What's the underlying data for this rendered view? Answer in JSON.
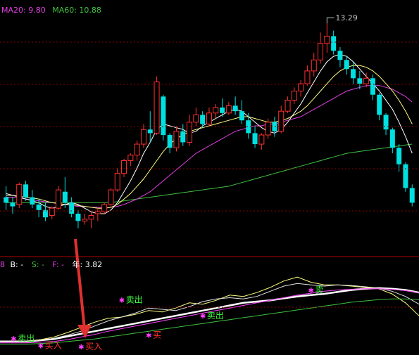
{
  "header": {
    "ma20_label": "MA20: 9.80",
    "ma60_label": "MA60: 10.88",
    "ma20_color": "#e040e0",
    "ma60_color": "#40c040"
  },
  "indicator_header": {
    "prefix": "8",
    "b_label": "B: -",
    "s_label": "S: -",
    "f_label": "F: -",
    "year_label": "年: 3.82",
    "b_color": "#ffffff",
    "s_color": "#40c040",
    "f_color": "#e040e0"
  },
  "chart_data": [
    {
      "type": "candlestick",
      "title": "",
      "up_color": "#ff3030",
      "down_color": "#00e0e0",
      "annotations": [
        {
          "text": "13.29",
          "at_candle": 49
        }
      ],
      "candles": [
        [
          9.9,
          10.5,
          9.2,
          9.6
        ],
        [
          9.6,
          9.9,
          9.0,
          9.4
        ],
        [
          9.5,
          10.7,
          9.3,
          10.6
        ],
        [
          10.6,
          10.8,
          9.7,
          9.9
        ],
        [
          9.9,
          10.3,
          9.3,
          9.5
        ],
        [
          9.5,
          9.8,
          8.8,
          9.2
        ],
        [
          9.2,
          9.6,
          8.6,
          8.8
        ],
        [
          8.9,
          9.4,
          8.7,
          9.3
        ],
        [
          9.3,
          10.5,
          9.2,
          10.3
        ],
        [
          10.2,
          11.0,
          9.3,
          9.6
        ],
        [
          9.6,
          9.9,
          8.8,
          9.0
        ],
        [
          9.0,
          9.2,
          8.2,
          8.6
        ],
        [
          8.6,
          9.0,
          8.4,
          8.7
        ],
        [
          8.7,
          9.1,
          8.2,
          8.9
        ],
        [
          9.0,
          9.3,
          8.6,
          9.1
        ],
        [
          9.1,
          9.6,
          9.0,
          9.5
        ],
        [
          9.5,
          10.4,
          9.4,
          10.3
        ],
        [
          10.3,
          11.5,
          10.2,
          11.2
        ],
        [
          11.2,
          12.0,
          11.0,
          11.9
        ],
        [
          11.9,
          12.3,
          11.6,
          12.2
        ],
        [
          12.2,
          13.0,
          11.9,
          12.8
        ],
        [
          12.8,
          13.9,
          12.6,
          13.6
        ],
        [
          13.6,
          14.6,
          12.9,
          13.4
        ],
        [
          13.4,
          16.5,
          13.3,
          16.2
        ],
        [
          15.4,
          15.5,
          13.0,
          13.3
        ],
        [
          13.3,
          13.4,
          12.3,
          12.6
        ],
        [
          12.6,
          13.8,
          12.4,
          13.5
        ],
        [
          13.5,
          13.9,
          12.7,
          12.9
        ],
        [
          12.9,
          14.4,
          12.7,
          14.0
        ],
        [
          14.0,
          14.8,
          13.8,
          14.4
        ],
        [
          14.4,
          14.6,
          13.7,
          13.9
        ],
        [
          13.9,
          14.8,
          13.8,
          14.5
        ],
        [
          14.5,
          15.0,
          14.2,
          14.8
        ],
        [
          14.8,
          15.3,
          14.3,
          14.5
        ],
        [
          14.5,
          15.1,
          14.4,
          14.9
        ],
        [
          14.9,
          15.4,
          14.4,
          14.6
        ],
        [
          14.6,
          15.2,
          13.9,
          14.1
        ],
        [
          14.1,
          14.5,
          13.1,
          13.4
        ],
        [
          13.4,
          13.8,
          12.6,
          12.8
        ],
        [
          12.8,
          13.4,
          12.5,
          13.3
        ],
        [
          13.3,
          14.2,
          13.1,
          14.0
        ],
        [
          14.0,
          14.3,
          13.2,
          13.5
        ],
        [
          13.5,
          14.9,
          13.4,
          14.6
        ],
        [
          14.6,
          15.4,
          14.5,
          15.2
        ],
        [
          15.2,
          15.9,
          15.0,
          15.7
        ],
        [
          15.7,
          16.3,
          15.4,
          16.1
        ],
        [
          16.1,
          17.1,
          16.0,
          16.8
        ],
        [
          16.8,
          17.8,
          16.5,
          17.4
        ],
        [
          17.4,
          18.9,
          17.2,
          18.3
        ],
        [
          18.3,
          19.4,
          17.8,
          18.7
        ],
        [
          18.7,
          19.0,
          17.7,
          17.9
        ],
        [
          17.9,
          18.1,
          17.0,
          17.4
        ],
        [
          17.4,
          17.6,
          16.6,
          16.9
        ],
        [
          16.9,
          17.3,
          16.1,
          16.4
        ],
        [
          16.4,
          16.8,
          15.8,
          16.1
        ],
        [
          16.1,
          16.7,
          15.9,
          16.4
        ],
        [
          16.4,
          16.6,
          15.2,
          15.5
        ],
        [
          15.5,
          15.6,
          14.1,
          14.4
        ],
        [
          14.4,
          14.5,
          13.3,
          13.6
        ],
        [
          13.6,
          13.7,
          12.3,
          12.6
        ],
        [
          12.6,
          12.8,
          11.3,
          11.7
        ],
        [
          11.7,
          11.8,
          10.2,
          10.4
        ],
        [
          10.4,
          10.6,
          9.4,
          9.6
        ]
      ],
      "ma5": [
        10.1,
        10.0,
        9.9,
        9.8,
        9.7,
        9.6,
        9.4,
        9.3,
        9.4,
        9.5,
        9.6,
        9.5,
        9.3,
        9.1,
        9.0,
        9.0,
        9.2,
        9.6,
        10.2,
        10.8,
        11.5,
        12.3,
        12.9,
        13.6,
        13.9,
        13.8,
        13.7,
        13.6,
        13.4,
        13.5,
        13.8,
        14.0,
        14.2,
        14.4,
        14.6,
        14.7,
        14.6,
        14.3,
        14.0,
        13.7,
        13.5,
        13.4,
        13.6,
        14.0,
        14.5,
        15.0,
        15.6,
        16.2,
        16.8,
        17.3,
        17.6,
        17.7,
        17.6,
        17.3,
        16.9,
        16.5,
        16.1,
        15.7,
        15.2,
        14.7,
        14.0,
        13.2,
        12.3
      ],
      "ma10": [
        10.0,
        10.0,
        9.95,
        9.9,
        9.85,
        9.8,
        9.7,
        9.6,
        9.55,
        9.5,
        9.5,
        9.45,
        9.4,
        9.35,
        9.3,
        9.3,
        9.35,
        9.5,
        9.8,
        10.1,
        10.5,
        10.9,
        11.4,
        11.9,
        12.4,
        12.8,
        13.1,
        13.3,
        13.5,
        13.6,
        13.7,
        13.8,
        13.9,
        14.0,
        14.1,
        14.2,
        14.3,
        14.3,
        14.2,
        14.1,
        14.0,
        14.0,
        14.1,
        14.2,
        14.4,
        14.6,
        14.9,
        15.3,
        15.7,
        16.1,
        16.5,
        16.8,
        17.0,
        17.1,
        17.1,
        17.0,
        16.8,
        16.5,
        16.1,
        15.7,
        15.2,
        14.6,
        13.9
      ],
      "ma20": [
        9.9,
        9.9,
        9.85,
        9.8,
        9.75,
        9.7,
        9.65,
        9.6,
        9.55,
        9.5,
        9.45,
        9.4,
        9.4,
        9.35,
        9.35,
        9.3,
        9.35,
        9.4,
        9.5,
        9.65,
        9.8,
        10.0,
        10.2,
        10.5,
        10.8,
        11.1,
        11.4,
        11.7,
        12.0,
        12.3,
        12.5,
        12.7,
        12.9,
        13.1,
        13.3,
        13.5,
        13.6,
        13.7,
        13.8,
        13.8,
        13.9,
        13.9,
        14.0,
        14.1,
        14.2,
        14.3,
        14.5,
        14.7,
        14.9,
        15.1,
        15.3,
        15.5,
        15.7,
        15.8,
        15.9,
        16.0,
        16.0,
        16.0,
        15.9,
        15.8,
        15.6,
        15.4,
        15.1
      ],
      "ma60": [
        9.6,
        9.6,
        9.6,
        9.6,
        9.6,
        9.6,
        9.6,
        9.6,
        9.6,
        9.6,
        9.6,
        9.6,
        9.6,
        9.6,
        9.6,
        9.6,
        9.62,
        9.65,
        9.7,
        9.75,
        9.8,
        9.85,
        9.9,
        9.95,
        10.0,
        10.05,
        10.1,
        10.15,
        10.2,
        10.25,
        10.3,
        10.35,
        10.4,
        10.45,
        10.5,
        10.6,
        10.7,
        10.8,
        10.9,
        11.0,
        11.1,
        11.2,
        11.3,
        11.4,
        11.5,
        11.6,
        11.7,
        11.8,
        11.9,
        12.0,
        12.1,
        12.2,
        12.3,
        12.35,
        12.4,
        12.45,
        12.5,
        12.55,
        12.6,
        12.65,
        12.7,
        12.75,
        12.8
      ]
    },
    {
      "type": "line",
      "title": "",
      "series": [
        {
          "color": "#ffffff",
          "values": [
            1,
            1,
            1,
            1.2,
            1.4,
            1.8,
            2.2,
            2.6,
            3.0,
            3.4,
            3.8,
            4.2,
            4.6,
            5.0,
            5.4,
            5.8,
            6.2,
            6.6,
            7.0,
            7.2,
            7.4,
            7.7,
            8.0,
            8.2,
            8.4,
            8.7,
            9.0,
            9.2,
            9.3,
            9.2,
            9.0,
            8.6
          ]
        },
        {
          "color": "#ffff80",
          "values": [
            1,
            1,
            1,
            1.3,
            1.7,
            2.4,
            3.2,
            4.0,
            4.6,
            4.8,
            5.2,
            5.8,
            5.6,
            6.2,
            7.0,
            6.8,
            7.4,
            8.2,
            8.0,
            8.6,
            9.4,
            10.4,
            11.0,
            10.2,
            9.8,
            9.8,
            9.6,
            9.4,
            9.2,
            8.4,
            7.0,
            5.0
          ]
        },
        {
          "color": "#e0e0e0",
          "values": [
            1,
            1,
            1,
            1.2,
            1.5,
            2.0,
            2.6,
            3.4,
            4.2,
            4.8,
            5.4,
            6.2,
            6.0,
            5.8,
            6.4,
            7.2,
            7.6,
            7.8,
            7.6,
            8.0,
            8.8,
            9.6,
            10.0,
            9.8,
            9.6,
            9.8,
            9.7,
            9.5,
            9.3,
            8.8,
            8.0,
            6.8
          ]
        },
        {
          "color": "#ff40ff",
          "values": [
            0.8,
            0.8,
            0.8,
            0.9,
            1.0,
            1.3,
            1.7,
            2.1,
            2.6,
            3.0,
            3.4,
            3.8,
            4.2,
            4.6,
            5.0,
            5.4,
            5.8,
            6.2,
            6.6,
            7.0,
            7.4,
            7.8,
            8.2,
            8.5,
            8.8,
            9.0,
            9.1,
            9.2,
            9.2,
            9.1,
            8.9,
            8.6
          ]
        },
        {
          "color": "#40c040",
          "values": [
            0.6,
            0.6,
            0.6,
            0.7,
            0.8,
            1.0,
            1.2,
            1.4,
            1.7,
            2.0,
            2.3,
            2.6,
            2.9,
            3.2,
            3.5,
            3.8,
            4.1,
            4.4,
            4.7,
            5.0,
            5.3,
            5.6,
            5.9,
            6.2,
            6.5,
            6.8,
            7.1,
            7.3,
            7.5,
            7.6,
            7.6,
            7.5
          ]
        }
      ],
      "signals": [
        {
          "text": "卖出",
          "color": "#40ff40",
          "index": 1,
          "value": 1.5
        },
        {
          "text": "买入",
          "color": "#ff3030",
          "index": 3,
          "value": 0.4
        },
        {
          "text": "买入",
          "color": "#ff3030",
          "index": 6,
          "value": 0.2
        },
        {
          "text": "卖出",
          "color": "#40ff40",
          "index": 9,
          "value": 7.5
        },
        {
          "text": "买",
          "color": "#ff3030",
          "index": 11,
          "value": 2.0
        },
        {
          "text": "卖出",
          "color": "#40ff40",
          "index": 15,
          "value": 5.0
        },
        {
          "text": "卖",
          "color": "#40ff40",
          "index": 23,
          "value": 9.0
        }
      ]
    }
  ]
}
